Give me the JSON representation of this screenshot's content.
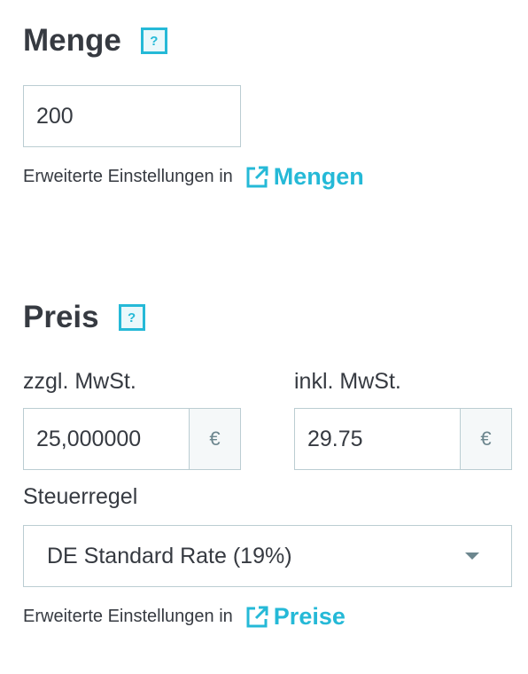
{
  "quantity": {
    "title": "Menge",
    "help": "?",
    "value": "200",
    "hint_text": "Erweiterte Einstellungen in",
    "hint_link": "Mengen"
  },
  "price": {
    "title": "Preis",
    "help": "?",
    "excl_label": "zzgl. MwSt.",
    "excl_value": "25,000000",
    "incl_label": "inkl. MwSt.",
    "incl_value": "29.75",
    "currency": "€",
    "tax_rule_label": "Steuerregel",
    "tax_rule_value": "DE Standard Rate (19%)",
    "hint_text": "Erweiterte Einstellungen in",
    "hint_link": "Preise"
  },
  "colors": {
    "accent": "#25b9d7",
    "text": "#363a41",
    "border": "#bbcdd2"
  },
  "icons": [
    "help-icon",
    "external-link-icon",
    "chevron-down-icon"
  ]
}
